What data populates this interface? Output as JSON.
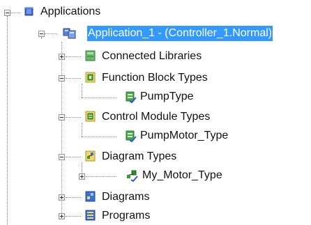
{
  "tree": {
    "root": {
      "label": "Applications",
      "icon": "applications-icon",
      "expanded": true
    },
    "application": {
      "label": "Application_1 - (Controller_1.Normal)",
      "icon": "application-icon",
      "expanded": true,
      "selected": true
    },
    "items": [
      {
        "label": "Connected Libraries",
        "icon": "connected-libraries-icon",
        "expander": "plus"
      },
      {
        "label": "Function Block Types",
        "icon": "function-block-types-icon",
        "expander": "minus",
        "children": [
          {
            "label": "PumpType",
            "icon": "function-block-type-icon"
          }
        ]
      },
      {
        "label": "Control Module Types",
        "icon": "control-module-types-icon",
        "expander": "minus",
        "children": [
          {
            "label": "PumpMotor_Type",
            "icon": "control-module-type-icon"
          }
        ]
      },
      {
        "label": "Diagram Types",
        "icon": "diagram-types-icon",
        "expander": "minus",
        "children": [
          {
            "label": "My_Motor_Type",
            "icon": "diagram-type-icon",
            "expander": "plus"
          }
        ]
      },
      {
        "label": "Diagrams",
        "icon": "diagrams-icon",
        "expander": "plus"
      },
      {
        "label": "Programs",
        "icon": "programs-icon",
        "expander": "plus"
      }
    ]
  },
  "colors": {
    "selection": "#3399ff",
    "connector": "#8d8d8d"
  }
}
